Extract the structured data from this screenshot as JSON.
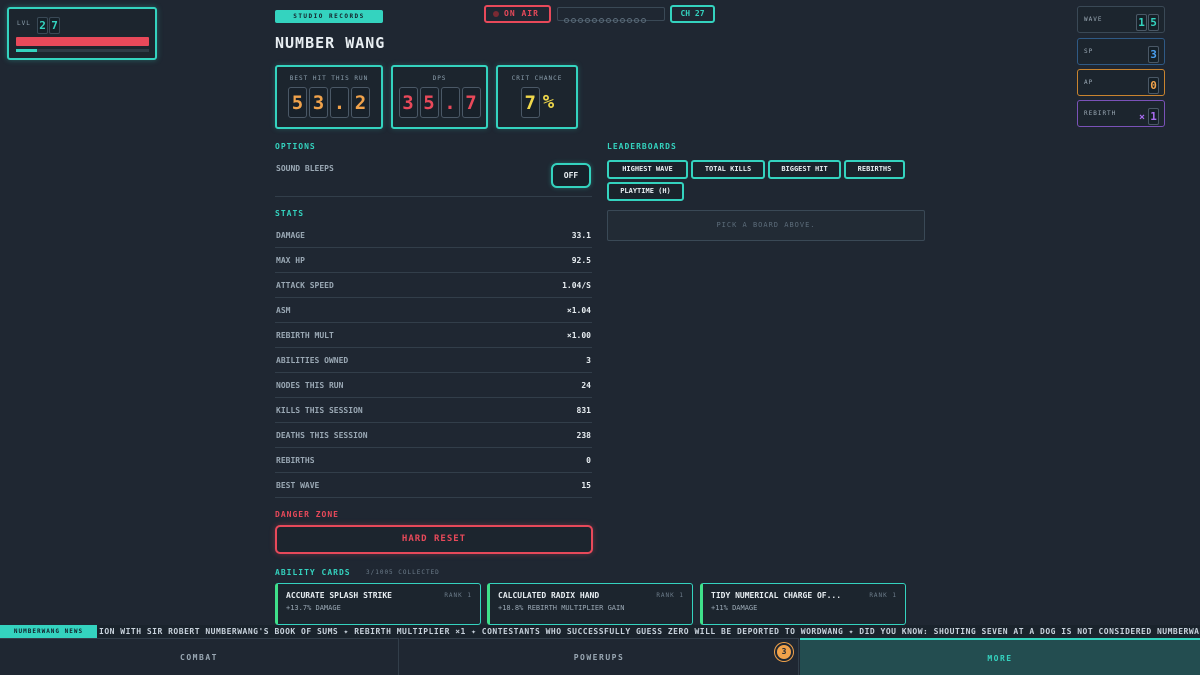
{
  "level": {
    "label": "LVL",
    "digits": [
      "2",
      "7"
    ],
    "hp_fraction": 1.0,
    "xp_fraction": 0.16
  },
  "header": {
    "badge": "STUDIO RECORDS",
    "title": "NUMBER WANG",
    "on_air": "ON AIR",
    "channel": "CH 27"
  },
  "cards": [
    {
      "label": "BEST HIT THIS RUN",
      "digits": [
        "5",
        "3",
        ".",
        "2"
      ],
      "color": "#f0a24b"
    },
    {
      "label": "DPS",
      "digits": [
        "3",
        "5",
        ".",
        "7"
      ],
      "color": "#e8495a"
    },
    {
      "label": "CRIT CHANCE",
      "digits": [
        "7"
      ],
      "suffix": "%",
      "color": "#f0d84b"
    }
  ],
  "options": {
    "heading": "OPTIONS",
    "sound_label": "SOUND BLEEPS",
    "sound_value": "OFF"
  },
  "stats": {
    "heading": "STATS",
    "rows": [
      {
        "k": "DAMAGE",
        "v": "33.1"
      },
      {
        "k": "MAX HP",
        "v": "92.5"
      },
      {
        "k": "ATTACK SPEED",
        "v": "1.04/S"
      },
      {
        "k": "ASM",
        "v": "×1.04"
      },
      {
        "k": "REBIRTH MULT",
        "v": "×1.00"
      },
      {
        "k": "ABILITIES OWNED",
        "v": "3"
      },
      {
        "k": "NODES THIS RUN",
        "v": "24"
      },
      {
        "k": "KILLS THIS SESSION",
        "v": "831"
      },
      {
        "k": "DEATHS THIS SESSION",
        "v": "238"
      },
      {
        "k": "REBIRTHS",
        "v": "0"
      },
      {
        "k": "BEST WAVE",
        "v": "15"
      }
    ]
  },
  "danger": {
    "heading": "DANGER ZONE",
    "button": "HARD RESET"
  },
  "abilities": {
    "heading": "ABILITY CARDS",
    "collected": "3/1005 COLLECTED",
    "cards": [
      {
        "name": "ACCURATE SPLASH STRIKE",
        "rank": "RANK 1",
        "desc": "+13.7% DAMAGE"
      },
      {
        "name": "CALCULATED RADIX HAND",
        "rank": "RANK 1",
        "desc": "+18.8% REBIRTH MULTIPLIER GAIN"
      },
      {
        "name": "TIDY NUMERICAL CHARGE OF...",
        "rank": "RANK 1",
        "desc": "+11% DAMAGE"
      }
    ]
  },
  "leaderboards": {
    "heading": "LEADERBOARDS",
    "buttons": [
      "HIGHEST WAVE",
      "TOTAL KILLS",
      "BIGGEST HIT",
      "REBIRTHS",
      "PLAYTIME (H)"
    ],
    "empty": "PICK A BOARD ABOVE."
  },
  "chips": [
    {
      "label": "WAVE",
      "digits": [
        "1",
        "5"
      ],
      "color": "#34d3bf"
    },
    {
      "label": "SP",
      "digits": [
        "3"
      ],
      "color": "#4a9ff0"
    },
    {
      "label": "AP",
      "digits": [
        "0"
      ],
      "color": "#f0a24b"
    },
    {
      "label": "REBIRTH",
      "prefix": "×",
      "digits": [
        "1"
      ],
      "color": "#a86cf0"
    }
  ],
  "ticker": {
    "label": "NUMBERWANG NEWS",
    "text": "ION WITH SIR ROBERT NUMBERWANG'S BOOK OF SUMS ✦ REBIRTH MULTIPLIER ×1 ✦ CONTESTANTS WHO SUCCESSFULLY GUESS ZERO WILL BE DEPORTED TO WORDWANG ✦ DID YOU KNOW: SHOUTING SEVEN AT A DOG IS NOT CONSIDERED NUMBERWANG"
  },
  "tabs": {
    "combat": "COMBAT",
    "powerups": "POWERUPS",
    "more": "MORE",
    "badge": "3"
  }
}
